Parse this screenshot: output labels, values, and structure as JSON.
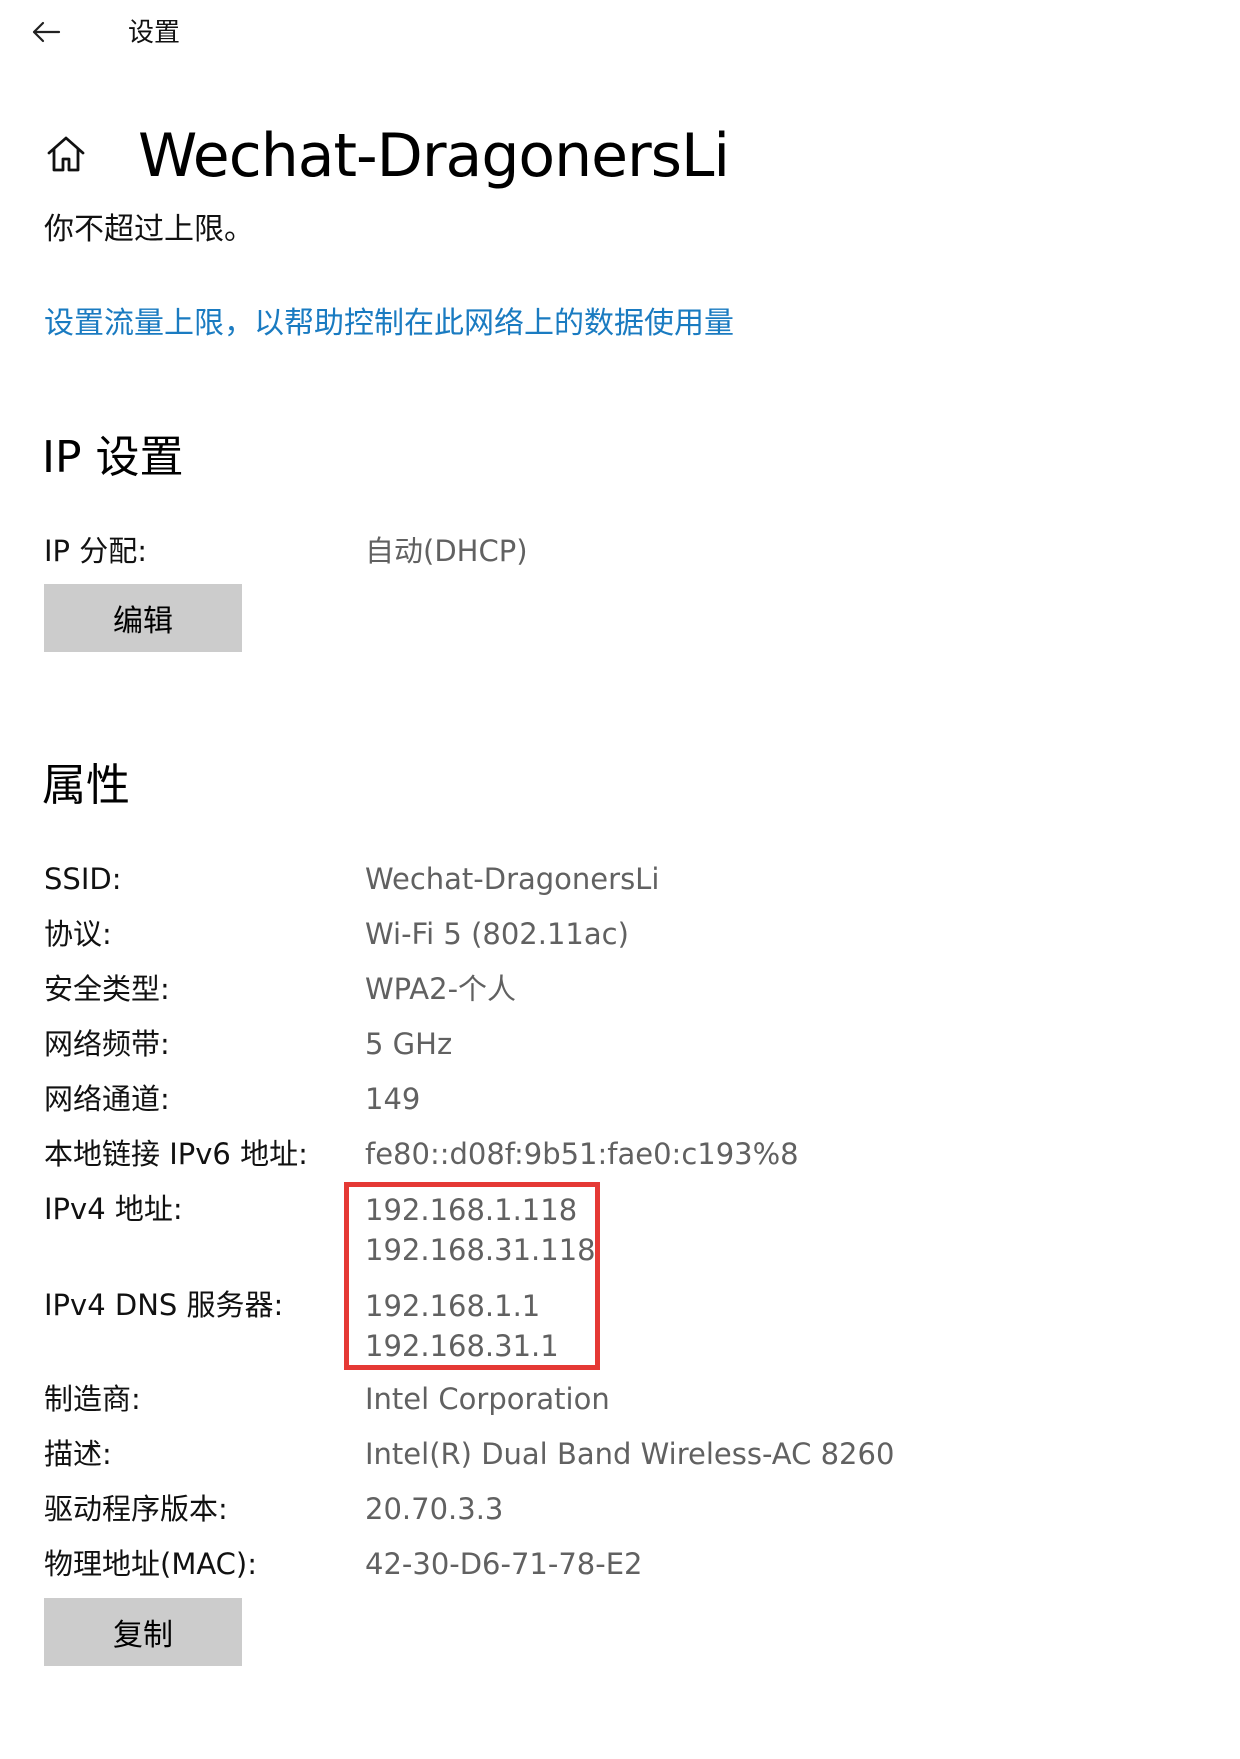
{
  "app": {
    "title": "设置"
  },
  "header": {
    "network_name": "Wechat-DragonersLi",
    "limit_status": "你不超过上限。",
    "data_limit_link": "设置流量上限，以帮助控制在此网络上的数据使用量"
  },
  "ip_settings": {
    "heading": "IP 设置",
    "assignment_label": "IP 分配:",
    "assignment_value": "自动(DHCP)",
    "edit_button": "编辑"
  },
  "properties": {
    "heading": "属性",
    "rows": [
      {
        "label": "SSID:",
        "value": "Wechat-DragonersLi"
      },
      {
        "label": "协议:",
        "value": "Wi-Fi 5 (802.11ac)"
      },
      {
        "label": "安全类型:",
        "value": "WPA2-个人"
      },
      {
        "label": "网络频带:",
        "value": "5 GHz"
      },
      {
        "label": "网络通道:",
        "value": "149"
      },
      {
        "label": "本地链接 IPv6 地址:",
        "value": "fe80::d08f:9b51:fae0:c193%8"
      },
      {
        "label": "IPv4 地址:",
        "values": [
          "192.168.1.118",
          "192.168.31.118"
        ]
      },
      {
        "label": "IPv4 DNS 服务器:",
        "values": [
          "192.168.1.1",
          "192.168.31.1"
        ]
      },
      {
        "label": "制造商:",
        "value": "Intel Corporation"
      },
      {
        "label": "描述:",
        "value": "Intel(R) Dual Band Wireless-AC 8260"
      },
      {
        "label": "驱动程序版本:",
        "value": "20.70.3.3"
      },
      {
        "label": "物理地址(MAC):",
        "value": "42-30-D6-71-78-E2"
      }
    ],
    "copy_button": "复制"
  },
  "highlight": {
    "color": "#e53935"
  },
  "colors": {
    "link": "#1a7bc1",
    "value_text": "#616161",
    "button_bg": "#cccccc"
  },
  "icons": {
    "back": "back-arrow-icon",
    "home": "home-icon"
  }
}
